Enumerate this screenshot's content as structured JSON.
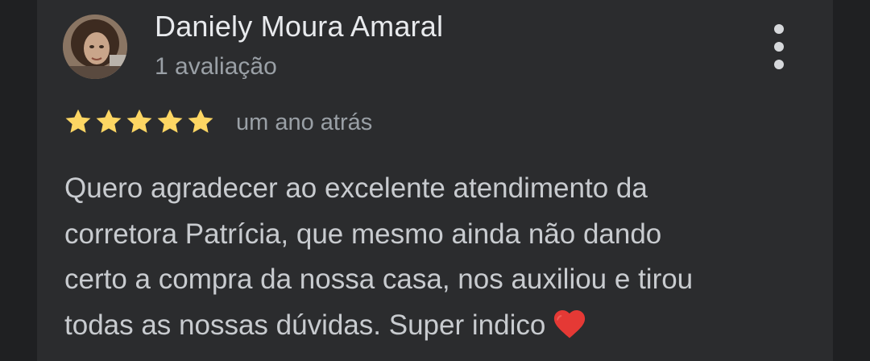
{
  "reviewer": {
    "name": "Daniely Moura Amaral",
    "review_count": "1 avaliação",
    "avatar_icon": "user-avatar"
  },
  "menu": {
    "icon": "more-vertical-icon"
  },
  "rating": {
    "stars": 5,
    "max": 5,
    "star_color": "#fdd663",
    "timestamp": "um ano atrás"
  },
  "review": {
    "lines": [
      "Quero agradecer ao excelente atendimento da",
      "corretora Patrícia, que mesmo ainda não dando",
      "certo a compra da nossa casa, nos auxiliou e tirou",
      "todas as nossas dúvidas. Super indico"
    ],
    "emoji": "heart-icon",
    "heart_color": "#e53935"
  },
  "colors": {
    "background": "#1f2022",
    "card": "#2b2c2e",
    "primary_text": "#e8eaed",
    "secondary_text": "#9aa0a6",
    "body_text": "#c8cbcf"
  }
}
